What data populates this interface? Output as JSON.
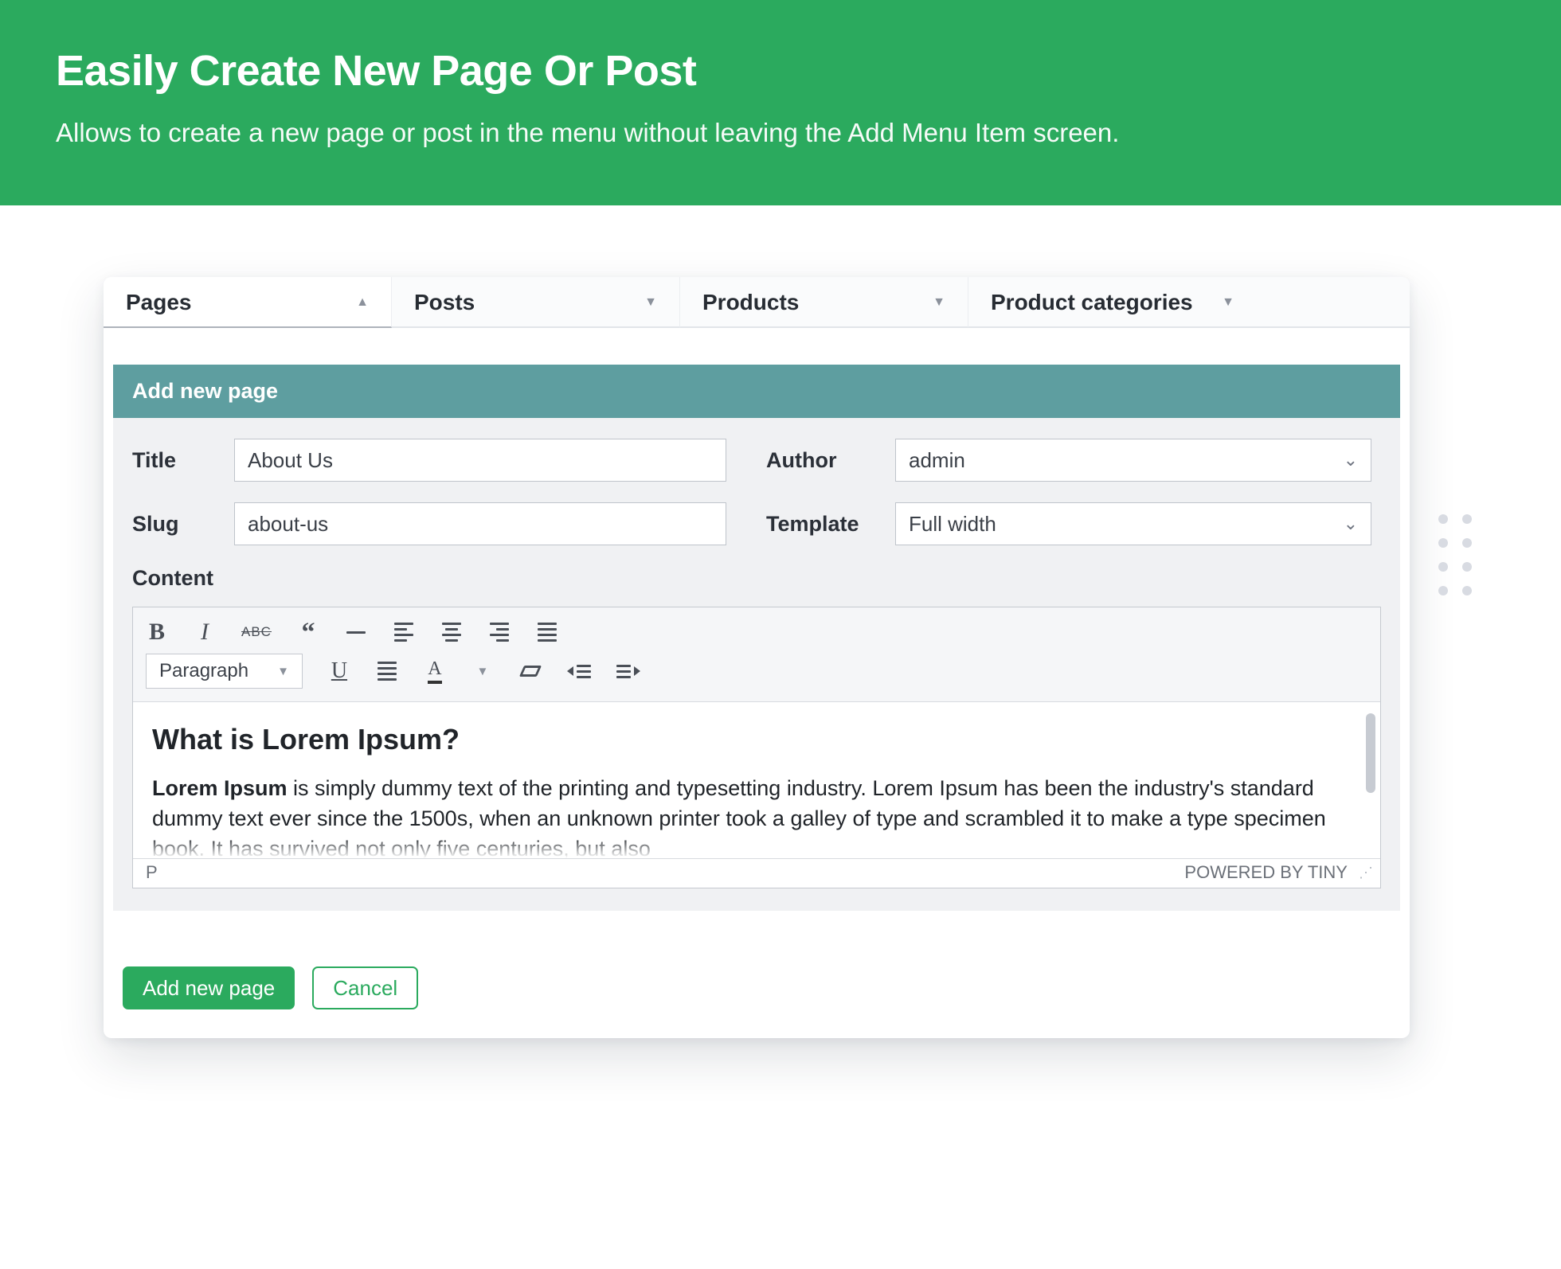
{
  "hero": {
    "title": "Easily Create New Page Or Post",
    "subtitle": "Allows to create a new page or post in the menu without leaving the Add Menu Item screen."
  },
  "tabs": [
    {
      "label": "Pages",
      "active": true
    },
    {
      "label": "Posts",
      "active": false
    },
    {
      "label": "Products",
      "active": false
    },
    {
      "label": "Product categories",
      "active": false
    }
  ],
  "section_bar": "Add new page",
  "form": {
    "title_label": "Title",
    "title_value": "About Us",
    "slug_label": "Slug",
    "slug_value": "about-us",
    "author_label": "Author",
    "author_value": "admin",
    "template_label": "Template",
    "template_value": "Full width",
    "content_label": "Content"
  },
  "editor": {
    "block_format": "Paragraph",
    "strike_label": "ABC",
    "heading": "What is Lorem Ipsum?",
    "strong_lead": "Lorem Ipsum",
    "body_text": " is simply dummy text of the printing and typesetting industry. Lorem Ipsum has been the industry's standard dummy text ever since the 1500s, when an unknown printer took a galley of type and scrambled it to make a type specimen book. It has survived not only five centuries, but also",
    "status_path": "P",
    "powered_by": "POWERED BY TINY"
  },
  "actions": {
    "primary": "Add new page",
    "secondary": "Cancel"
  }
}
